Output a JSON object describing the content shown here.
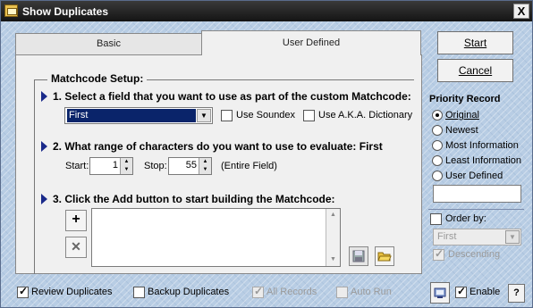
{
  "window": {
    "title": "Show Duplicates",
    "close_label": "X"
  },
  "tabs": [
    {
      "label": "Basic"
    },
    {
      "label": "User Defined"
    }
  ],
  "matchcode": {
    "title": "Matchcode Setup:",
    "step1": "1. Select a field that you want to use as part of the custom Matchcode:",
    "field_value": "First",
    "use_soundex": "Use Soundex",
    "use_aka": "Use A.K.A. Dictionary",
    "step2": "2. What range of characters do you want to use to evaluate: First",
    "start_label": "Start:",
    "start_value": "1",
    "stop_label": "Stop:",
    "stop_value": "55",
    "entire_field": "(Entire Field)",
    "step3": "3. Click the Add button to start building the Matchcode:",
    "add_symbol": "+",
    "remove_symbol": "✕"
  },
  "buttons": {
    "start": "Start",
    "cancel": "Cancel",
    "help": "?"
  },
  "priority": {
    "title": "Priority Record",
    "options": [
      "Original",
      "Newest",
      "Most Information",
      "Least Information",
      "User Defined"
    ],
    "selected": "Original"
  },
  "order_by": {
    "label": "Order by:",
    "value": "First",
    "descending": "Descending"
  },
  "bottom": {
    "review": "Review Duplicates",
    "backup": "Backup Duplicates",
    "all_records": "All Records",
    "auto_run": "Auto Run",
    "enable": "Enable"
  },
  "colors": {
    "title_bar": "#141414",
    "accent_arrow": "#1a2a8a",
    "selection": "#0a246a"
  }
}
